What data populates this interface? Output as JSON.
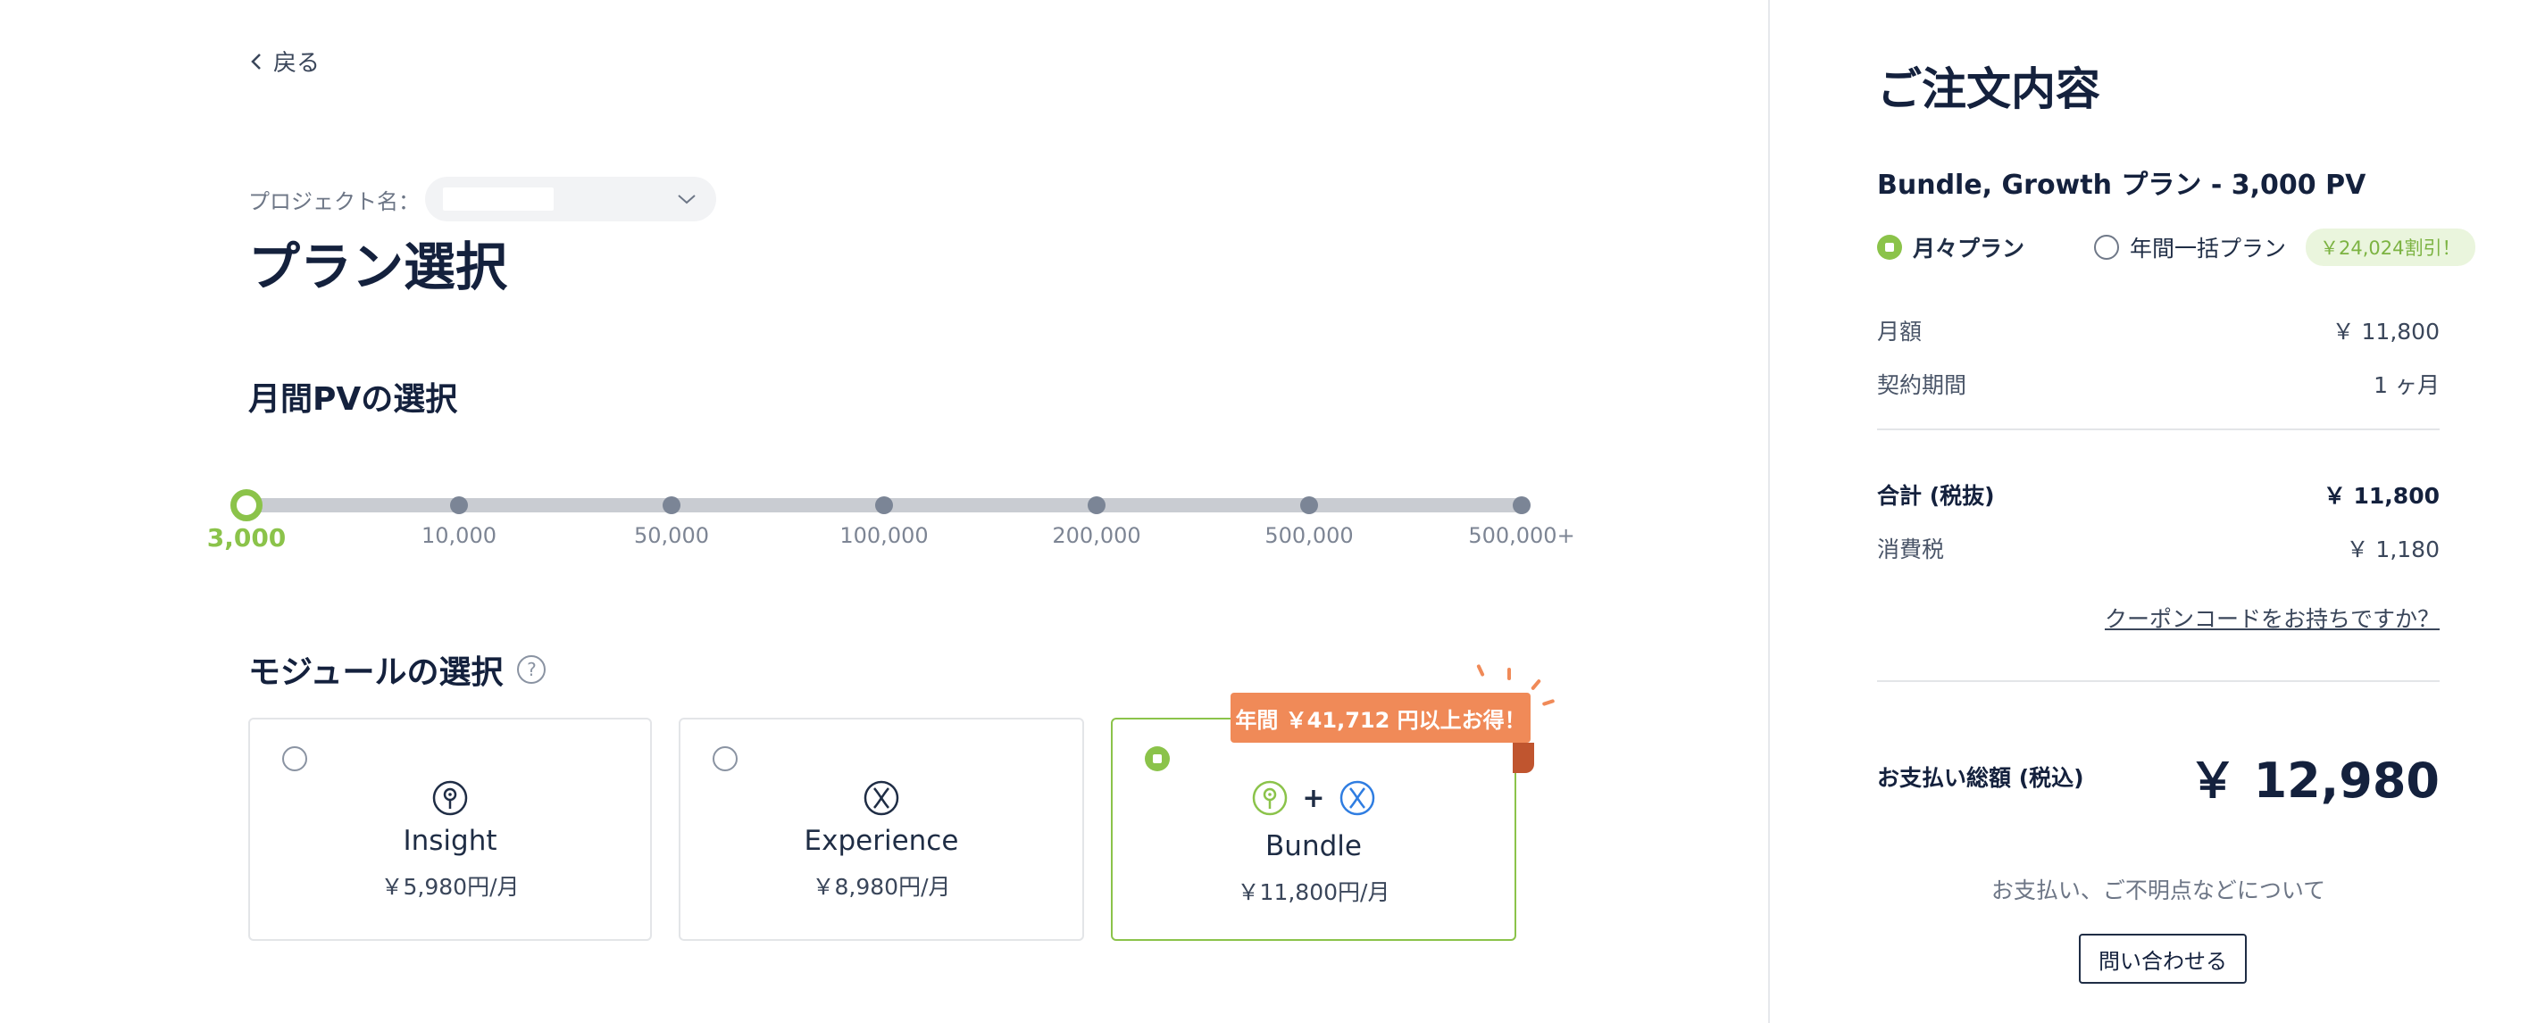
{
  "nav": {
    "back_label": "戻る"
  },
  "project": {
    "label": "プロジェクト名："
  },
  "page_title": "プラン選択",
  "pv": {
    "title": "月間PVの選択",
    "stops": [
      "3,000",
      "10,000",
      "50,000",
      "100,000",
      "200,000",
      "500,000",
      "500,000+"
    ],
    "selected": "3,000"
  },
  "modules": {
    "title": "モジュールの選択",
    "help_glyph": "?",
    "cards": [
      {
        "name": "Insight",
        "price": "￥5,980円/月",
        "icon": "bulb-icon",
        "selected": false
      },
      {
        "name": "Experience",
        "price": "￥8,980円/月",
        "icon": "x-figure-icon",
        "selected": false
      },
      {
        "name": "Bundle",
        "price": "￥11,800円/月",
        "icon": "bulb-plus-x-icon",
        "selected": true
      }
    ],
    "promo": "年間 ￥41,712 円以上お得！",
    "plus": "+"
  },
  "order": {
    "title": "ご注文内容",
    "plan": "Bundle, Growth プラン - 3,000 PV",
    "billing": {
      "monthly": "月々プラン",
      "annual": "年間一括プラン",
      "discount": "￥24,024割引！",
      "selected": "monthly"
    },
    "monthly_label": "月額",
    "monthly_value": "￥ 11,800",
    "term_label": "契約期間",
    "term_value": "1 ヶ月",
    "subtotal_label": "合計 (税抜)",
    "subtotal_value": "￥ 11,800",
    "tax_label": "消費税",
    "tax_value": "￥ 1,180",
    "coupon": "クーポンコードをお持ちですか？",
    "total_label": "お支払い総額 (税込)",
    "total_value": "￥ 12,980",
    "help_text": "お支払い、ご不明点などについて",
    "contact_button": "問い合わせる"
  },
  "colors": {
    "accent": "#8bc34a",
    "promo": "#f08a58",
    "text": "#14213d"
  }
}
